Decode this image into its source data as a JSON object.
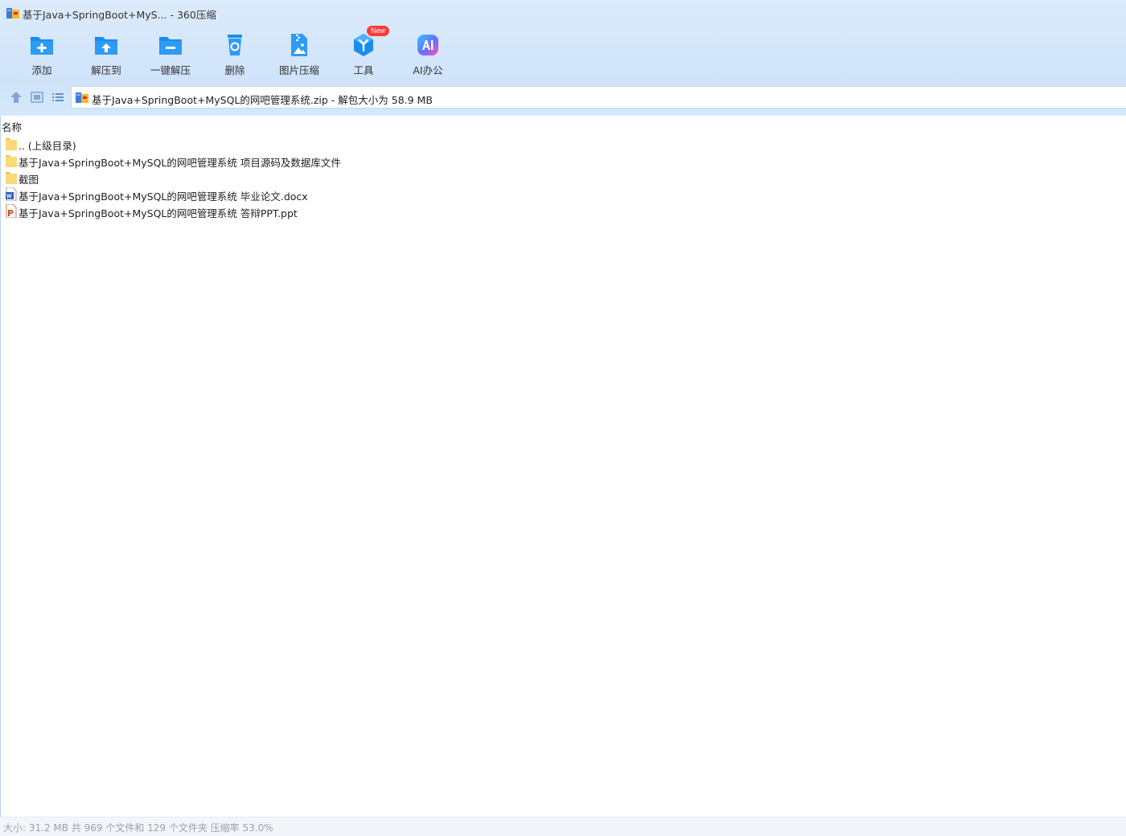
{
  "window": {
    "title": "基于Java+SpringBoot+MyS... - 360压缩"
  },
  "toolbar": {
    "items": [
      {
        "label": "添加",
        "icon": "add-folder-icon"
      },
      {
        "label": "解压到",
        "icon": "extract-to-icon"
      },
      {
        "label": "一键解压",
        "icon": "one-click-extract-icon"
      },
      {
        "label": "删除",
        "icon": "recycle-bin-icon"
      },
      {
        "label": "图片压缩",
        "icon": "image-compress-icon"
      },
      {
        "label": "工具",
        "icon": "tools-cube-icon",
        "badge": "New"
      },
      {
        "label": "AI办公",
        "icon": "ai-office-icon"
      }
    ]
  },
  "address": {
    "text": "基于Java+SpringBoot+MySQL的网吧管理系统.zip - 解包大小为 58.9 MB"
  },
  "file_list": {
    "column_name": "名称",
    "rows": [
      {
        "name": ".. (上级目录)",
        "type": "folder"
      },
      {
        "name": "基于Java+SpringBoot+MySQL的网吧管理系统 项目源码及数据库文件",
        "type": "folder"
      },
      {
        "name": "截图",
        "type": "folder"
      },
      {
        "name": "基于Java+SpringBoot+MySQL的网吧管理系统 毕业论文.docx",
        "type": "docx"
      },
      {
        "name": "基于Java+SpringBoot+MySQL的网吧管理系统 答辩PPT.ppt",
        "type": "ppt"
      }
    ]
  },
  "status": {
    "text": "大小: 31.2 MB 共 969 个文件和 129 个文件夹 压缩率 53.0%"
  },
  "colors": {
    "accent": "#1a8cf0",
    "badge": "#ff3b3b",
    "folder": "#f7d774"
  }
}
